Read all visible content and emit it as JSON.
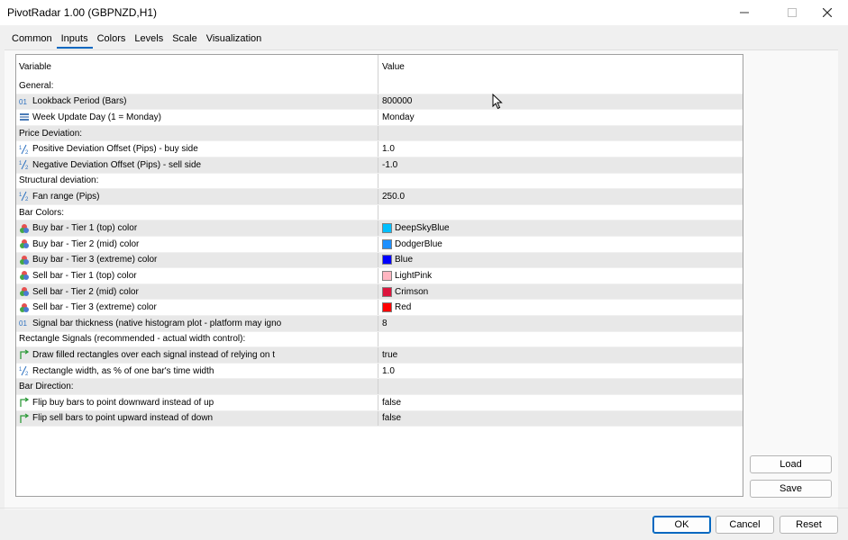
{
  "window": {
    "title": "PivotRadar 1.00 (GBPNZD,H1)"
  },
  "tabs": [
    "Common",
    "Inputs",
    "Colors",
    "Levels",
    "Scale",
    "Visualization"
  ],
  "table": {
    "headers": {
      "variable": "Variable",
      "value": "Value"
    },
    "rows": [
      {
        "type": "group",
        "label": "General:"
      },
      {
        "icon": "integer-icon",
        "label": "Lookback Period (Bars)",
        "value": "800000"
      },
      {
        "icon": "enum-icon",
        "label": "Week Update Day (1 = Monday)",
        "value": "Monday"
      },
      {
        "type": "group",
        "label": "Price Deviation:"
      },
      {
        "icon": "double-icon",
        "label": "Positive Deviation Offset (Pips) - buy side",
        "value": "1.0"
      },
      {
        "icon": "double-icon",
        "label": "Negative Deviation Offset (Pips) - sell side",
        "value": "-1.0"
      },
      {
        "type": "group",
        "label": "Structural deviation:"
      },
      {
        "icon": "double-icon",
        "label": "Fan range (Pips)",
        "value": "250.0"
      },
      {
        "type": "group",
        "label": "Bar Colors:"
      },
      {
        "icon": "color-icon",
        "label": "Buy bar - Tier 1 (top) color",
        "value": "DeepSkyBlue",
        "swatch": "#00bfff"
      },
      {
        "icon": "color-icon",
        "label": "Buy bar - Tier 2 (mid) color",
        "value": "DodgerBlue",
        "swatch": "#1e90ff"
      },
      {
        "icon": "color-icon",
        "label": "Buy bar - Tier 3 (extreme) color",
        "value": "Blue",
        "swatch": "#0000ff"
      },
      {
        "icon": "color-icon",
        "label": "Sell bar - Tier 1 (top) color",
        "value": "LightPink",
        "swatch": "#ffb6c1"
      },
      {
        "icon": "color-icon",
        "label": "Sell bar - Tier 2 (mid) color",
        "value": "Crimson",
        "swatch": "#dc143c"
      },
      {
        "icon": "color-icon",
        "label": "Sell bar - Tier 3 (extreme) color",
        "value": "Red",
        "swatch": "#ff0000"
      },
      {
        "icon": "integer-icon",
        "label": "Signal bar thickness (native histogram plot - platform may igno",
        "value": "8"
      },
      {
        "type": "group",
        "label": "Rectangle Signals (recommended - actual width control):"
      },
      {
        "icon": "bool-icon",
        "label": "Draw filled rectangles over each signal instead of relying on t",
        "value": "true"
      },
      {
        "icon": "double-icon",
        "label": "Rectangle width, as % of one bar's time width",
        "value": "1.0"
      },
      {
        "type": "group",
        "label": "Bar Direction:"
      },
      {
        "icon": "bool-icon",
        "label": "Flip buy bars to point downward instead of up",
        "value": "false"
      },
      {
        "icon": "bool-icon",
        "label": "Flip sell bars to point upward instead of down",
        "value": "false"
      }
    ]
  },
  "buttons": {
    "load": "Load",
    "save": "Save",
    "ok": "OK",
    "cancel": "Cancel",
    "reset": "Reset"
  }
}
